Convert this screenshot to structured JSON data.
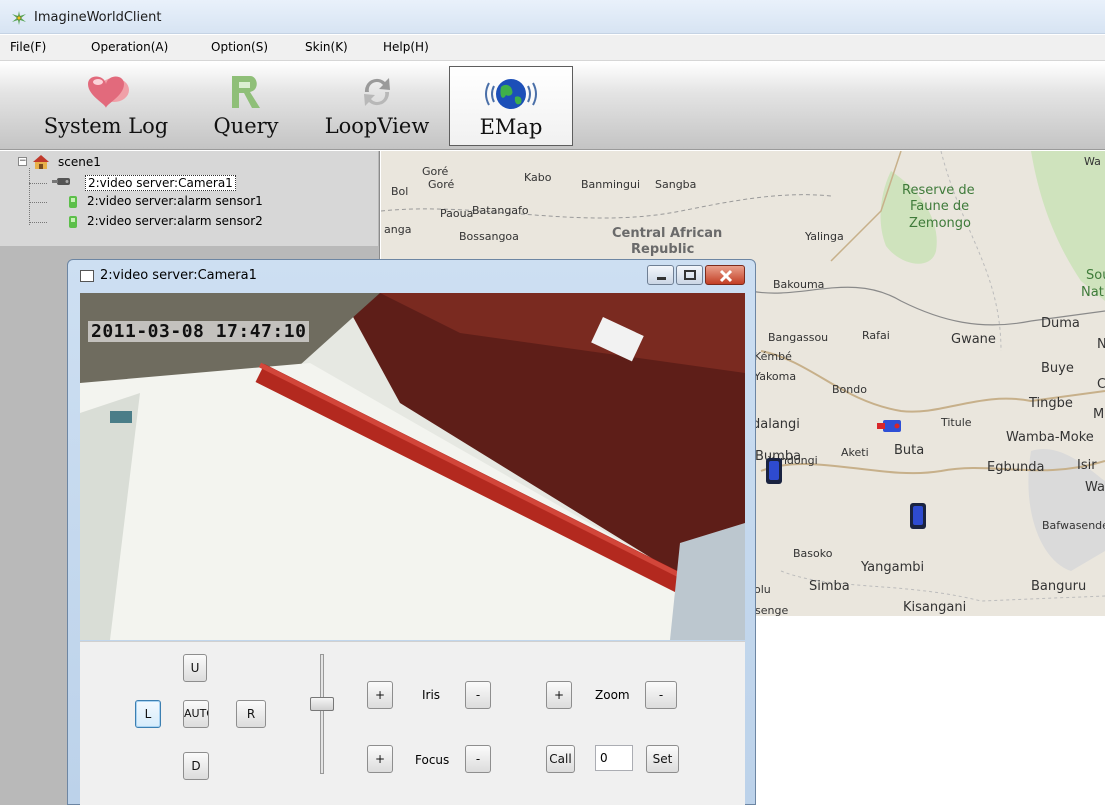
{
  "window": {
    "title": "ImagineWorldClient"
  },
  "menu": [
    {
      "label": "File(F)"
    },
    {
      "label": "Operation(A)"
    },
    {
      "label": "Option(S)"
    },
    {
      "label": "Skin(K)"
    },
    {
      "label": "Help(H)"
    }
  ],
  "toolbar": {
    "system_log": "System Log",
    "query": "Query",
    "loopview": "LoopView",
    "emap": "EMap"
  },
  "tree": {
    "root": "scene1",
    "nodes": [
      {
        "label": "2:video server:Camera1"
      },
      {
        "label": "2:video server:alarm sensor1"
      },
      {
        "label": "2:video server:alarm sensor2"
      }
    ]
  },
  "map": {
    "labels": [
      "Goré",
      "Bol",
      "Goré",
      "Kabo",
      "Banmingui",
      "Sangba",
      "Paoua",
      "Batangafo",
      "Reserve de",
      "Faune de",
      "Zemongo",
      "anga",
      "Bossangoa",
      "Central African",
      "Republic",
      "Yalinga",
      "Sou",
      "Natio",
      "Bakouma",
      "Duma",
      "Bangassou",
      "Rafai",
      "Gwane",
      "Kémbé",
      "Buye",
      "Yakoma",
      "Bondo",
      "Tingbe",
      "M",
      "dalangi",
      "Titule",
      "Wamba-Moke",
      "Aketi",
      "Buta",
      "Yandongi",
      "Egbunda",
      "Isir",
      "Bumba",
      "Wam",
      "Bafwasende",
      "Basoko",
      "Yangambi",
      "Simba",
      "olu",
      "Banguru",
      "Kisangani",
      "isenge",
      "N",
      "C",
      "Wa"
    ]
  },
  "camera_window": {
    "title": "2:video server:Camera1",
    "timestamp": "2011-03-08 17:47:10",
    "controls": {
      "up": "U",
      "left": "L",
      "auto": "AUTO",
      "right": "R",
      "down": "D",
      "plus": "+",
      "minus": "-",
      "iris": "Iris",
      "focus": "Focus",
      "zoom": "Zoom",
      "call": "Call",
      "set": "Set",
      "preset_value": "0"
    }
  }
}
